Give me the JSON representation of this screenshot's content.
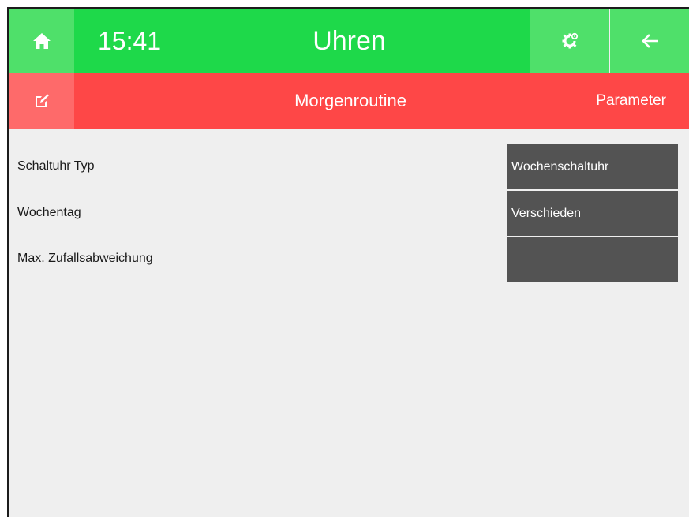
{
  "header": {
    "time": "15:41",
    "title": "Uhren",
    "icons": {
      "home": "home-icon",
      "settings": "settings-gear-icon",
      "back": "back-arrow-icon"
    }
  },
  "subheader": {
    "edit_icon": "edit-icon",
    "title": "Morgenroutine",
    "tab_label": "Parameter"
  },
  "rows": [
    {
      "label": "Schaltuhr Typ",
      "value": "Wochenschaltuhr"
    },
    {
      "label": "Wochentag",
      "value": "Verschieden"
    },
    {
      "label": "Max. Zufallsabweichung",
      "value": ""
    }
  ],
  "colors": {
    "green_dark": "#1ed94a",
    "green_light": "#4fe06a",
    "red": "#fe4747",
    "red_light": "#fe6a6a",
    "value_bg": "#535353",
    "content_bg": "#efefef"
  }
}
